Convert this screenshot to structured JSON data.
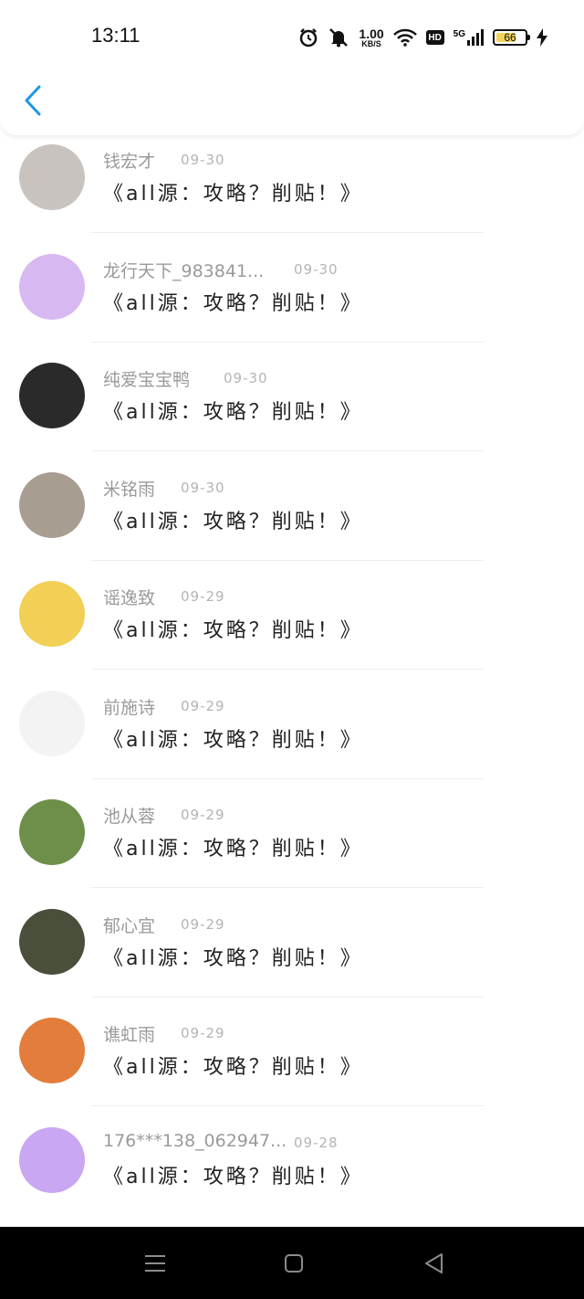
{
  "status_bar": {
    "time": "13:11",
    "speed_value": "1.00",
    "speed_unit": "KB/S",
    "hd_label": "HD",
    "network": "5G",
    "battery": "66"
  },
  "messages": [
    {
      "name": "钱宏才",
      "date": "09-30",
      "text": "《all源：攻略？削贴！》",
      "avatar_color": "#c9c3bf"
    },
    {
      "name": "龙行天下_983841...",
      "date": "09-30",
      "text": "《all源：攻略？削贴！》",
      "avatar_color": "#d8b8f0"
    },
    {
      "name": "纯爱宝宝鸭",
      "date": "09-30",
      "text": "《all源：攻略？削贴！》",
      "avatar_color": "#2a2a2a"
    },
    {
      "name": "米铭雨",
      "date": "09-30",
      "text": "《all源：攻略？削贴！》",
      "avatar_color": "#a89d91"
    },
    {
      "name": "谣逸致",
      "date": "09-29",
      "text": "《all源：攻略？削贴！》",
      "avatar_color": "#f2cf55"
    },
    {
      "name": "前施诗",
      "date": "09-29",
      "text": "《all源：攻略？削贴！》",
      "avatar_color": "#f3f3f3"
    },
    {
      "name": "池从蓉",
      "date": "09-29",
      "text": "《all源：攻略？削贴！》",
      "avatar_color": "#6e8f4a"
    },
    {
      "name": "郁心宜",
      "date": "09-29",
      "text": "《all源：攻略？削贴！》",
      "avatar_color": "#4a4f3b"
    },
    {
      "name": "谯虹雨",
      "date": "09-29",
      "text": "《all源：攻略？削贴！》",
      "avatar_color": "#e37d3b"
    },
    {
      "name": "176***138_062947...",
      "date": "09-28",
      "text": "《all源：攻略？削贴！》",
      "avatar_color": "#c9a7f2"
    }
  ],
  "accent_color": "#1e96e6"
}
